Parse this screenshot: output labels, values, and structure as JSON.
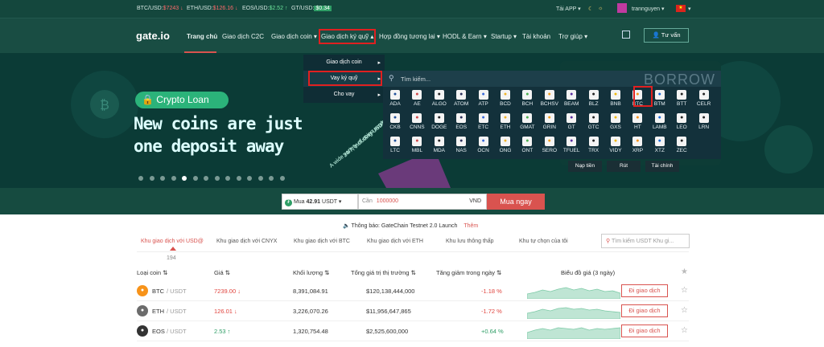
{
  "ticker": {
    "btc_label": "BTC/USD:",
    "btc_value": "$7243",
    "btc_arrow": "↓",
    "eth_label": "ETH/USD:",
    "eth_value": "$126.16",
    "eth_arrow": "↓",
    "eos_label": "EOS/USD:",
    "eos_value": "$2.52",
    "eos_arrow": "↑",
    "gt_label": "GT/USD:",
    "gt_value": "$0.34",
    "app": "Tải APP",
    "user": "trannguyen"
  },
  "nav": {
    "logo": "gate.io",
    "items": [
      "Trang chủ",
      "Giao dịch C2C",
      "Giao dịch coin",
      "Giao dịch ký quỹ",
      "Hợp đồng tương lai",
      "HODL & Earn",
      "Startup",
      "Tài khoản",
      "Trợ giúp"
    ],
    "consult": "Tư vấn"
  },
  "banner": {
    "pill": "Crypto Loan",
    "line1": "New coins are just",
    "line2": "one deposit away",
    "side_text": "A wide variety of coins avail...",
    "side_text2": "24/7, including USDT",
    "borrow": "BORROW",
    "actions": [
      "Nạp tiền",
      "Rút",
      "Tài chính"
    ]
  },
  "menu": {
    "items": [
      "Giao dịch coin",
      "Vay ký quỹ",
      "Cho vay"
    ]
  },
  "coin_panel": {
    "search_placeholder": "Tìm kiếm...",
    "rows": [
      [
        "ADA",
        "AE",
        "ALGO",
        "ATOM",
        "ATP",
        "BCD",
        "BCH",
        "BCHSV",
        "BEAM",
        "BLZ",
        "BNB",
        "BTC",
        "BTM",
        "BTT",
        "CELR"
      ],
      [
        "CKB",
        "CNNS",
        "DOGE",
        "EOS",
        "ETC",
        "ETH",
        "GMAT",
        "GRIN",
        "GT",
        "GTC",
        "GXS",
        "HT",
        "LAMB",
        "LEO",
        "LRN"
      ],
      [
        "LTC",
        "MBL",
        "MDA",
        "NAS",
        "OCN",
        "ONG",
        "ONT",
        "SERO",
        "TFUEL",
        "TRX",
        "VIDY",
        "XRP",
        "XTZ",
        "ZEC"
      ]
    ]
  },
  "order": {
    "buy_label": "Mua",
    "buy_value": "42.91",
    "buy_unit": "USDT",
    "spend_label": "Cần",
    "spend_value": "1000000",
    "spend_unit": "VND",
    "button": "Mua ngay"
  },
  "notice": {
    "label": "Thông báo:",
    "text": "GateChain Testnet 2.0 Launch",
    "more": "Thêm"
  },
  "market_tabs": [
    "Khu giao dịch với USD@",
    "Khu giao dịch với CNYX",
    "Khu giao dịch với BTC",
    "Khu giao dịch với ETH",
    "Khu lưu thông thấp",
    "Khu tự chọn của tôi"
  ],
  "active_count": "194",
  "market_search_placeholder": "Tìm kiếm USDT Khu gi...",
  "table": {
    "headers": [
      "Loại coin",
      "Giá",
      "Khối lượng",
      "Tổng giá trị thị trường",
      "Tăng giảm trong ngày",
      "Biểu đồ giá (3 ngày)"
    ],
    "rows": [
      {
        "coin": "BTC",
        "pair": "/ USDT",
        "price": "7239.00 ↓",
        "volume": "8,391,084.91",
        "cap": "$120,138,444,000",
        "change": "-1.18 %",
        "action": "Đi giao dịch"
      },
      {
        "coin": "ETH",
        "pair": "/ USDT",
        "price": "126.01 ↓",
        "volume": "3,226,070.26",
        "cap": "$11,956,647,865",
        "change": "-1.72 %",
        "action": "Đi giao dịch"
      },
      {
        "coin": "EOS",
        "pair": "/ USDT",
        "price": "2.53 ↑",
        "volume": "1,320,754.48",
        "cap": "$2,525,600,000",
        "change": "+0.64 %",
        "action": "Đi giao dịch"
      }
    ]
  },
  "colors": {
    "up": "#2f9e66",
    "down": "#e0443e",
    "accent": "#d9534f",
    "nav_bg": "#194d43"
  }
}
